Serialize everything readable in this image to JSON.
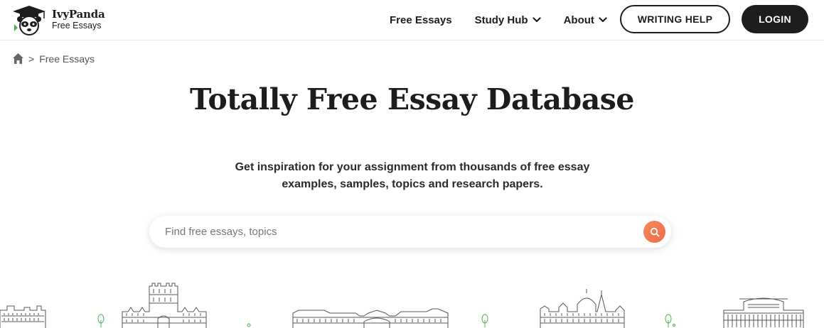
{
  "header": {
    "logo": {
      "name": "IvyPanda",
      "sub": "Free Essays"
    },
    "nav": [
      {
        "label": "Free Essays",
        "has_dropdown": false
      },
      {
        "label": "Study Hub",
        "has_dropdown": true
      },
      {
        "label": "About",
        "has_dropdown": true
      }
    ],
    "writing_help_label": "WRITING HELP",
    "login_label": "LOGIN"
  },
  "breadcrumb": {
    "separator": ">",
    "current": "Free Essays"
  },
  "hero": {
    "title": "Totally Free Essay Database",
    "subtitle_line1": "Get inspiration for your assignment from thousands of free essay",
    "subtitle_line2": "examples, samples, topics and research papers."
  },
  "search": {
    "placeholder": "Find free essays, topics",
    "value": ""
  },
  "colors": {
    "dark": "#1d1d1f",
    "accent": "#f27450",
    "tree_green": "#4caf50"
  },
  "icons": {
    "home": "home-icon",
    "search": "search-icon",
    "chevron": "chevron-down-icon"
  }
}
